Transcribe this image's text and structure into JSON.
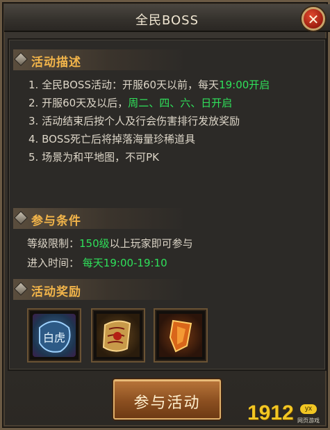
{
  "window": {
    "title": "全民BOSS",
    "close_icon": "close-icon"
  },
  "sections": {
    "description": {
      "title": "活动描述",
      "items": [
        {
          "num": "1.",
          "text": "全民BOSS活动：开服60天以前，每天",
          "highlight": "19:00开启"
        },
        {
          "num": "2.",
          "text": "开服60天及以后，",
          "highlight": "周二、四、六、日开启"
        },
        {
          "num": "3.",
          "text": "活动结束后按个人及行会伤害排行发放奖励",
          "highlight": ""
        },
        {
          "num": "4.",
          "text": "BOSS死亡后将掉落海量珍稀道具",
          "highlight": ""
        },
        {
          "num": "5.",
          "text": "场景为和平地图，不可PK",
          "highlight": ""
        }
      ]
    },
    "conditions": {
      "title": "参与条件",
      "level_label": "等级限制：",
      "level_value": "150级",
      "level_suffix": "以上玩家即可参与",
      "time_label": "进入时间：",
      "time_value": "每天19:00-19:10"
    },
    "rewards": {
      "title": "活动奖励",
      "items": [
        {
          "icon": "white-tiger-medal-icon",
          "label": "白虎"
        },
        {
          "icon": "scroll-icon"
        },
        {
          "icon": "shield-fragment-icon"
        }
      ]
    }
  },
  "actions": {
    "join_label": "参与活动"
  },
  "watermark": {
    "big": "1912",
    "badge": "yx",
    "small": "网页游戏"
  },
  "colors": {
    "accent_gold": "#f3b54a",
    "highlight_green": "#2fe05a"
  }
}
